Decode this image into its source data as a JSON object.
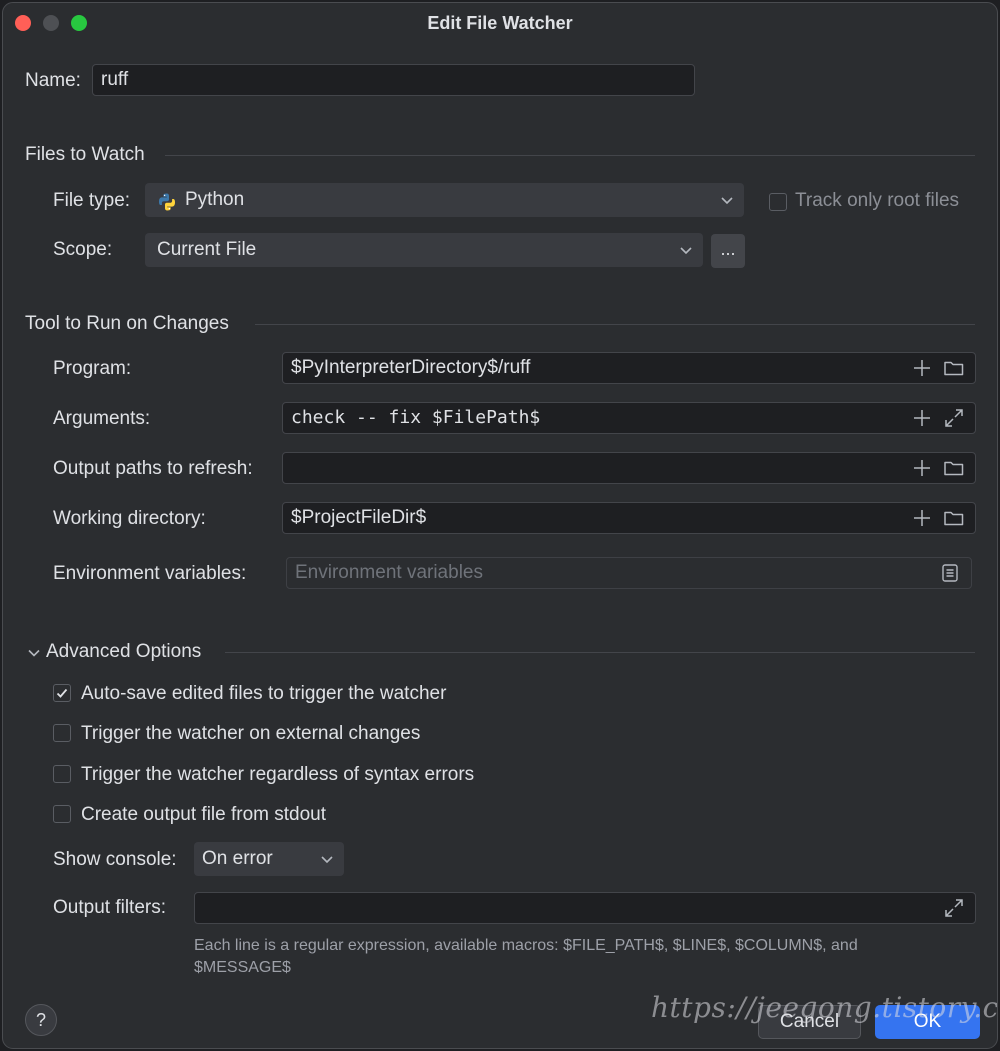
{
  "window": {
    "title": "Edit File Watcher"
  },
  "name": {
    "label": "Name:",
    "value": "ruff"
  },
  "files_to_watch": {
    "section_title": "Files to Watch",
    "file_type_label": "File type:",
    "file_type_value": "Python",
    "file_type_icon": "python-icon",
    "track_root_label": "Track only root files",
    "track_root_checked": false,
    "scope_label": "Scope:",
    "scope_value": "Current File",
    "scope_more_label": "..."
  },
  "tool": {
    "section_title": "Tool to Run on Changes",
    "program_label": "Program:",
    "program_value": "$PyInterpreterDirectory$/ruff",
    "arguments_label": "Arguments:",
    "arguments_value": "check -- fix $FilePath$",
    "output_paths_label": "Output paths to refresh:",
    "output_paths_value": "",
    "working_dir_label": "Working directory:",
    "working_dir_value": "$ProjectFileDir$",
    "env_label": "Environment variables:",
    "env_placeholder": "Environment variables"
  },
  "advanced": {
    "section_title": "Advanced Options",
    "options": [
      {
        "label": "Auto-save edited files to trigger the watcher",
        "checked": true
      },
      {
        "label": "Trigger the watcher on external changes",
        "checked": false
      },
      {
        "label": "Trigger the watcher regardless of syntax errors",
        "checked": false
      },
      {
        "label": "Create output file from stdout",
        "checked": false
      }
    ],
    "show_console_label": "Show console:",
    "show_console_value": "On error",
    "output_filters_label": "Output filters:",
    "output_filters_value": "",
    "hint_line1": "Each line is a regular expression, available macros: $FILE_PATH$, $LINE$, $COLUMN$, and",
    "hint_line2": "$MESSAGE$"
  },
  "footer": {
    "help_label": "?",
    "cancel_label": "Cancel",
    "ok_label": "OK",
    "watermark": "https://jeegong.tistory.com"
  },
  "colors": {
    "background": "#2b2d30",
    "field": "#1e1f22",
    "accent": "#3574f0",
    "python_blue": "#3c78aa",
    "python_yellow": "#ffd43b"
  }
}
